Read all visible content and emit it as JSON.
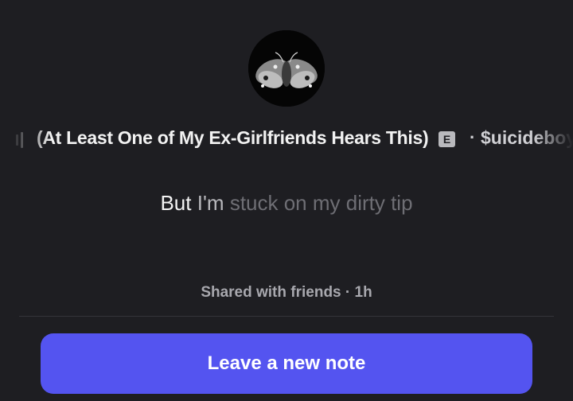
{
  "track": {
    "title": "(At Least One of My Ex-Girlfriends Hears This)",
    "explicit_badge": "E",
    "separator": "·",
    "artist": "$uicideboy$"
  },
  "icons": {
    "now_playing": "now-playing-bars-icon",
    "avatar": "moth-avatar"
  },
  "lyric": {
    "word_current": "But",
    "word_next": "I'm",
    "word_upcoming": "stuck on my dirty tip"
  },
  "note": {
    "shared_text": "Shared with friends · 1h"
  },
  "actions": {
    "leave_note_label": "Leave a new note"
  },
  "colors": {
    "background": "#1e1e22",
    "button": "#5454f0",
    "text_primary": "#f2f2f2",
    "text_muted": "#a8a8ae"
  }
}
